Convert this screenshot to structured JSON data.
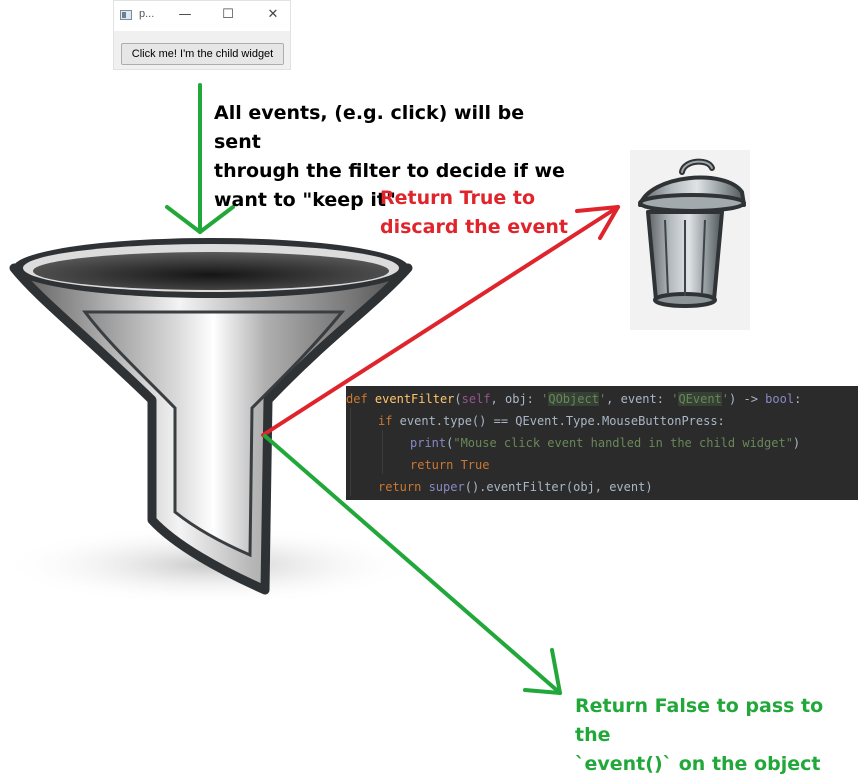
{
  "window": {
    "title": "p...",
    "minimize_glyph": "—",
    "maximize_glyph": "☐",
    "close_glyph": "✕",
    "child_button_label": "Click me! I'm the child widget"
  },
  "annotations": {
    "events_line1": "All events, (e.g. click) will be sent",
    "events_line2": "through the filter to decide if we",
    "events_line3": "want to \"keep it\"",
    "discard_line1": "Return True to",
    "discard_line2": "discard the event",
    "pass_line1": "Return False to pass to the",
    "pass_line2": "`event()` on the object"
  },
  "code": {
    "l1_def": "def",
    "l1_name": "eventFilter",
    "l1_open": "(",
    "l1_self": "self",
    "l1_obj": ", obj: ",
    "l1_q1": "'",
    "l1_qobject": "QObject",
    "l1_q2": "'",
    "l1_event": ", event: ",
    "l1_q3": "'",
    "l1_qevent": "QEvent",
    "l1_q4": "'",
    "l1_arrow": ") -> ",
    "l1_bool": "bool",
    "l1_colon": ":",
    "l2_if": "if",
    "l2_rest": " event.type() == QEvent.Type.MouseButtonPress:",
    "l3_print": "print",
    "l3_open": "(",
    "l3_str": "\"Mouse click event handled in the child widget\"",
    "l3_close": ")",
    "l4_return": "return",
    "l4_true": " True",
    "l5_return": "return",
    "l5_super": " super",
    "l5_rest": "().eventFilter(obj, event)"
  },
  "colors": {
    "input_arrow": "#22a83a",
    "discard_arrow": "#e0242b",
    "pass_arrow": "#22a83a",
    "code_bg": "#2b2b2b"
  },
  "icons": [
    "app-window-icon",
    "minimize-icon",
    "maximize-icon",
    "close-icon",
    "funnel-icon",
    "trash-can-icon"
  ]
}
